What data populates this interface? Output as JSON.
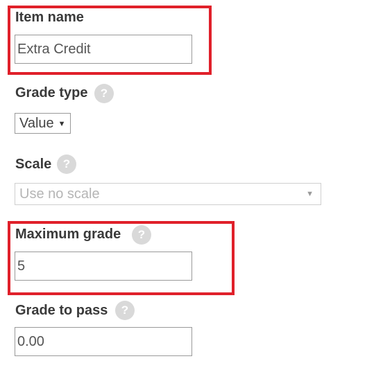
{
  "fields": {
    "item_name": {
      "label": "Item name",
      "value": "Extra Credit"
    },
    "grade_type": {
      "label": "Grade type",
      "selected": "Value",
      "help_icon": "question-mark"
    },
    "scale": {
      "label": "Scale",
      "selected": "Use no scale",
      "disabled": true,
      "help_icon": "question-mark"
    },
    "maximum_grade": {
      "label": "Maximum grade",
      "value": "5",
      "help_icon": "question-mark"
    },
    "grade_to_pass": {
      "label": "Grade to pass",
      "value": "0.00",
      "help_icon": "question-mark"
    }
  },
  "help_glyph": "?",
  "highlight_color": "#e0202a"
}
